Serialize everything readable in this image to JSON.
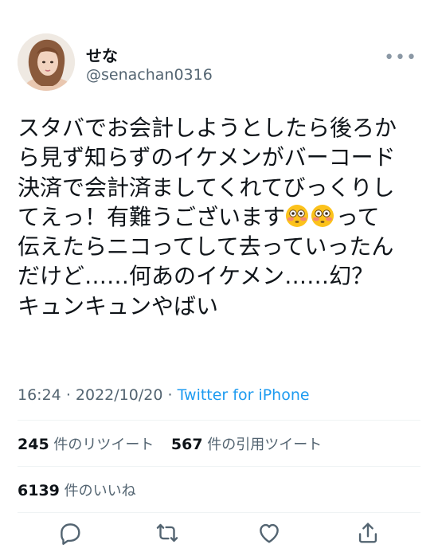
{
  "tweet": {
    "display_name": "せな",
    "handle": "@senachan0316",
    "lines": [
      "スタバでお会計しようとしたら後ろか",
      "ら見ず知らずのイケメンがバーコード",
      "決済で会計済ましてくれてびっくりし",
      "てえっ！有難うございます",
      "って",
      "伝えたらニコってして去っていったん",
      "だけど……何あのイケメン……幻？",
      "キュンキュンやばい"
    ],
    "time": "16:24",
    "dot": "·",
    "date": "2022/10/20",
    "source": "Twitter for iPhone"
  },
  "stats": {
    "retweets": "245",
    "retweets_label": "件のリツイート",
    "quotes": "567",
    "quotes_label": "件の引用ツイート",
    "likes": "6139",
    "likes_label": "件のいいね"
  },
  "icons": {
    "more": "more-dots-icon",
    "reply": "reply-icon",
    "retweet": "retweet-icon",
    "like": "heart-icon",
    "share": "share-icon",
    "emoji": "flushed-face-emoji"
  },
  "colors": {
    "text": "#0f1419",
    "secondary": "#536471",
    "link": "#1d9bf0",
    "divider": "#eff3f4"
  }
}
